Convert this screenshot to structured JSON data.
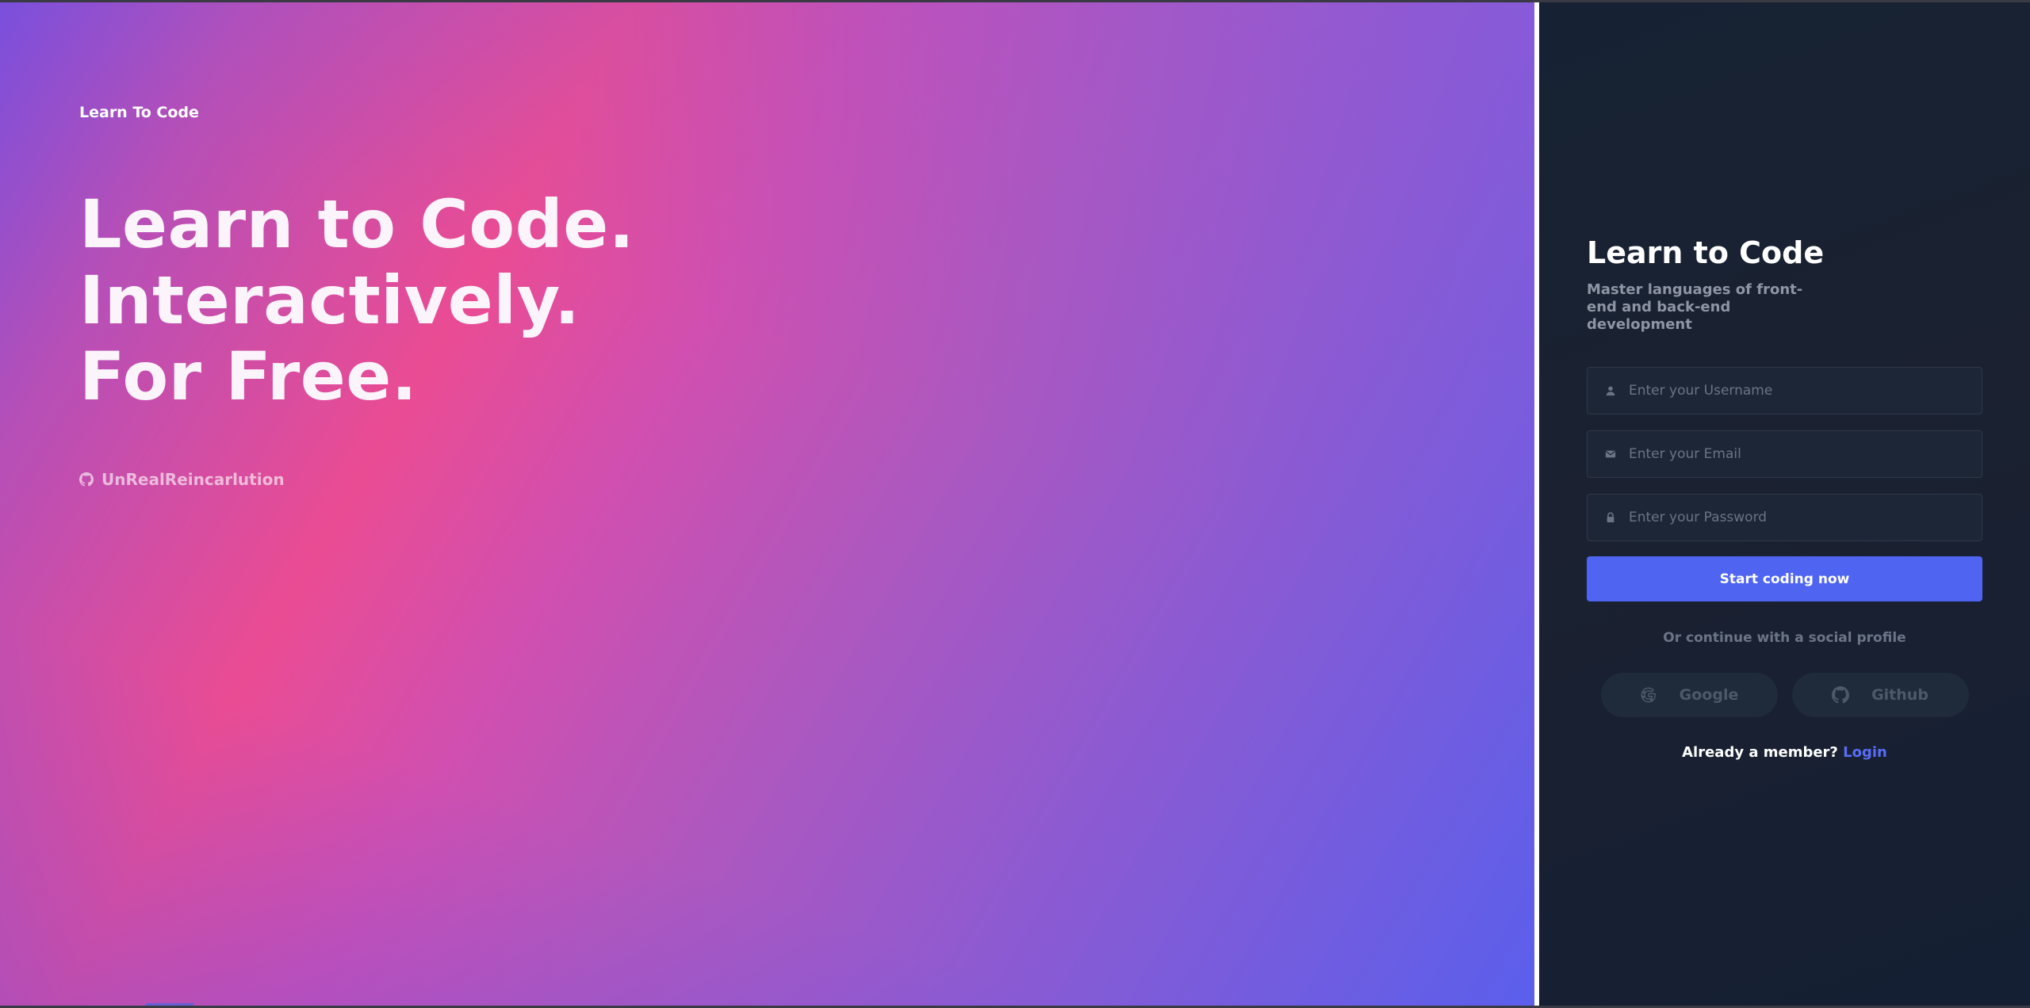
{
  "hero": {
    "brand": "Learn To Code",
    "headline": [
      "Learn to Code.",
      "Interactively.",
      "For Free."
    ],
    "github_user": "UnRealReincarlution"
  },
  "form": {
    "title": "Learn to Code",
    "subtitle": "Master languages of front-end and back-end development",
    "username_placeholder": "Enter your Username",
    "email_placeholder": "Enter your Email",
    "password_placeholder": "Enter your Password",
    "submit_label": "Start coding now",
    "social_prompt": "Or continue with a social profile",
    "social": [
      {
        "label": "Google",
        "icon": "google-icon"
      },
      {
        "label": "Github",
        "icon": "github-icon"
      }
    ],
    "member_text": "Already a member?",
    "login_label": "Login"
  },
  "colors": {
    "accent": "#4f65f2",
    "panel_bg": "#1b2130",
    "gradient_pink": "#ea4c93",
    "gradient_blue": "#5a5fec"
  }
}
